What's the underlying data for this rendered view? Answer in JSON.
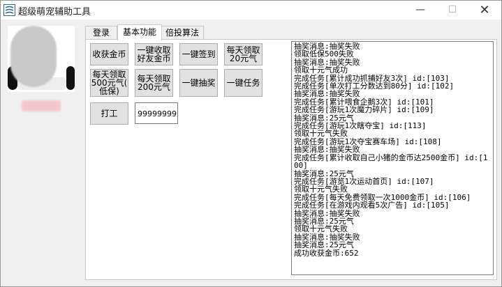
{
  "window": {
    "title": "超级萌宠辅助工具",
    "min_glyph": "—",
    "max_glyph": "☐",
    "close_glyph": "✕"
  },
  "tabs": [
    "登录",
    "基本功能",
    "倍投算法"
  ],
  "active_tab": 1,
  "buttons": {
    "harvest_coins": "收获金币",
    "collect_friend_coins": "一键收取\n好友金币",
    "checkin": "一键签到",
    "daily_20": "每天领取\n20元气",
    "daily_500": "每天领取\n500元气(\n低保)",
    "daily_200": "每天领取\n200元气",
    "lottery": "一键抽奖",
    "tasks": "一键任务",
    "work": "打工"
  },
  "coin_input": {
    "value": "99999999"
  },
  "log_lines": [
    "抽奖消息:抽奖失败",
    "领取低保500失败",
    "抽奖消息:抽奖失败",
    "领取十元气成功",
    "完成任务[累计成功抓捕好友3次] id:[103]",
    "完成任务[单次打工分数达到80分] id:[102]",
    "抽奖消息:抽奖失败",
    "完成任务[累计喂食企鹅3次] id:[101]",
    "完成任务[游玩1次魔力碎片] id:[109]",
    "抽奖消息:25元气",
    "完成任务[游玩1次瞎夺宝] id:[113]",
    "领取十元气失败",
    "完成任务[游玩1次夺宝赛车场] id:[108]",
    "抽奖消息:抽奖失败",
    "完成任务[累计收取自己小猪的金币达2500金币] id:[100]",
    "抽奖消息:25元气",
    "完成任务[游览1次运动首页] id:[107]",
    "领取十元气失败",
    "完成任务[每天免费领取一次1000金币] id:[106]",
    "完成任务[在游戏内观看5次广告] id:[105]",
    "抽奖消息:抽奖失败",
    "抽奖消息:25元气",
    "领取十元气失败",
    "抽奖消息:抽奖失败",
    "抽奖消息:25元气",
    "成功收获金币:652"
  ]
}
